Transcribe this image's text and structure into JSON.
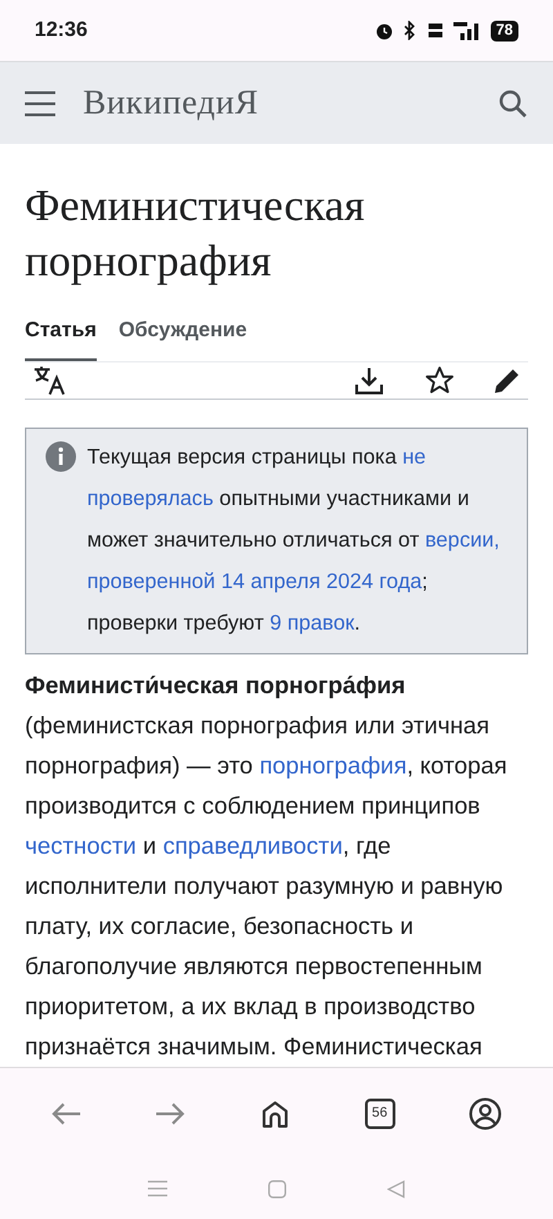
{
  "status_bar": {
    "time": "12:36",
    "battery": "78"
  },
  "header": {
    "logo": "ВикипедиЯ"
  },
  "title": "Феминистическая порнография",
  "tabs": [
    {
      "label": "Статья",
      "selected": true
    },
    {
      "label": "Обсуждение",
      "selected": false
    }
  ],
  "notice": [
    {
      "kind": "plain",
      "text": "Текущая версия страницы пока "
    },
    {
      "kind": "link",
      "text": "не"
    },
    {
      "kind": "link",
      "text": "проверялась"
    },
    {
      "kind": "plain",
      "text": " опытными участниками и может значительно отличаться от "
    },
    {
      "kind": "link",
      "text": "версии,"
    },
    {
      "kind": "link",
      "text": "проверенной 14 апреля 2024 года"
    },
    {
      "kind": "plain",
      "text": "; проверки требуют "
    },
    {
      "kind": "link",
      "text": "9 правок"
    },
    {
      "kind": "plain",
      "text": "."
    }
  ],
  "article": [
    {
      "kind": "bold",
      "text": "Феминисти́ческая порногра́фия"
    },
    {
      "kind": "plain",
      "text": " (феминистская порнография или этичная порнография) — это "
    },
    {
      "kind": "link",
      "text": "порнография"
    },
    {
      "kind": "plain",
      "text": ", которая производится с соблюдением принципов "
    },
    {
      "kind": "link",
      "text": "честности"
    },
    {
      "kind": "plain",
      "text": " и "
    },
    {
      "kind": "link",
      "text": "справедливости"
    },
    {
      "kind": "plain",
      "text": ", где исполнители получают разумную и равную плату, их согласие, безопасность и благополучие являются первостепенным приоритетом, а их вклад в производство признаётся значимым. Феминистическая"
    }
  ],
  "bottom_bar": {
    "tabs_count": "56"
  }
}
